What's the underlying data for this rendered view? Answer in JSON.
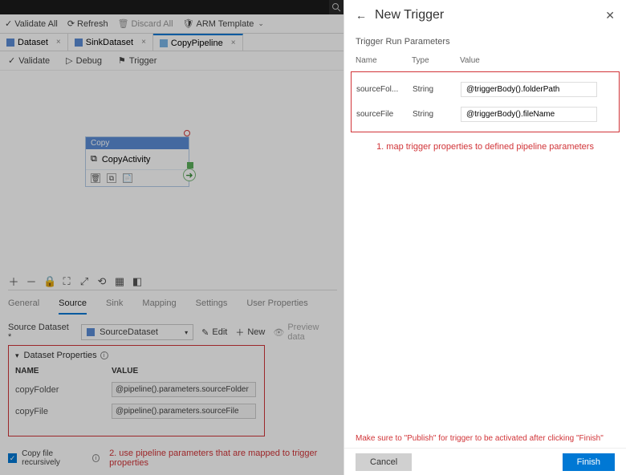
{
  "toolbar": {
    "validate_all": "Validate All",
    "refresh": "Refresh",
    "discard_all": "Discard All",
    "arm_template": "ARM Template"
  },
  "tabs": [
    {
      "label": "Dataset"
    },
    {
      "label": "SinkDataset"
    },
    {
      "label": "CopyPipeline"
    }
  ],
  "canvasbar": {
    "validate": "Validate",
    "debug": "Debug",
    "trigger": "Trigger"
  },
  "copybox": {
    "head": "Copy",
    "name": "CopyActivity"
  },
  "lowtabs": [
    "General",
    "Source",
    "Sink",
    "Mapping",
    "Settings",
    "User Properties"
  ],
  "source": {
    "label": "Source Dataset *",
    "value": "SourceDataset",
    "edit": "Edit",
    "new": "New",
    "preview": "Preview data"
  },
  "dprop": {
    "title": "Dataset Properties",
    "col_name": "NAME",
    "col_value": "VALUE",
    "rows": [
      {
        "name": "copyFolder",
        "value": "@pipeline().parameters.sourceFolder"
      },
      {
        "name": "copyFile",
        "value": "@pipeline().parameters.sourceFile"
      }
    ]
  },
  "copyrec": "Copy file recursively",
  "ann2": "2. use pipeline parameters that are mapped to trigger properties",
  "panel": {
    "title": "New Trigger",
    "sub": "Trigger Run Parameters",
    "cols": {
      "name": "Name",
      "type": "Type",
      "value": "Value"
    },
    "rows": [
      {
        "name": "sourceFol...",
        "type": "String",
        "value": "@triggerBody().folderPath"
      },
      {
        "name": "sourceFile",
        "type": "String",
        "value": "@triggerBody().fileName"
      }
    ],
    "ann1": "1. map trigger properties to defined pipeline parameters",
    "footnote": "Make sure to \"Publish\" for trigger to be activated after clicking \"Finish\"",
    "cancel": "Cancel",
    "finish": "Finish"
  }
}
